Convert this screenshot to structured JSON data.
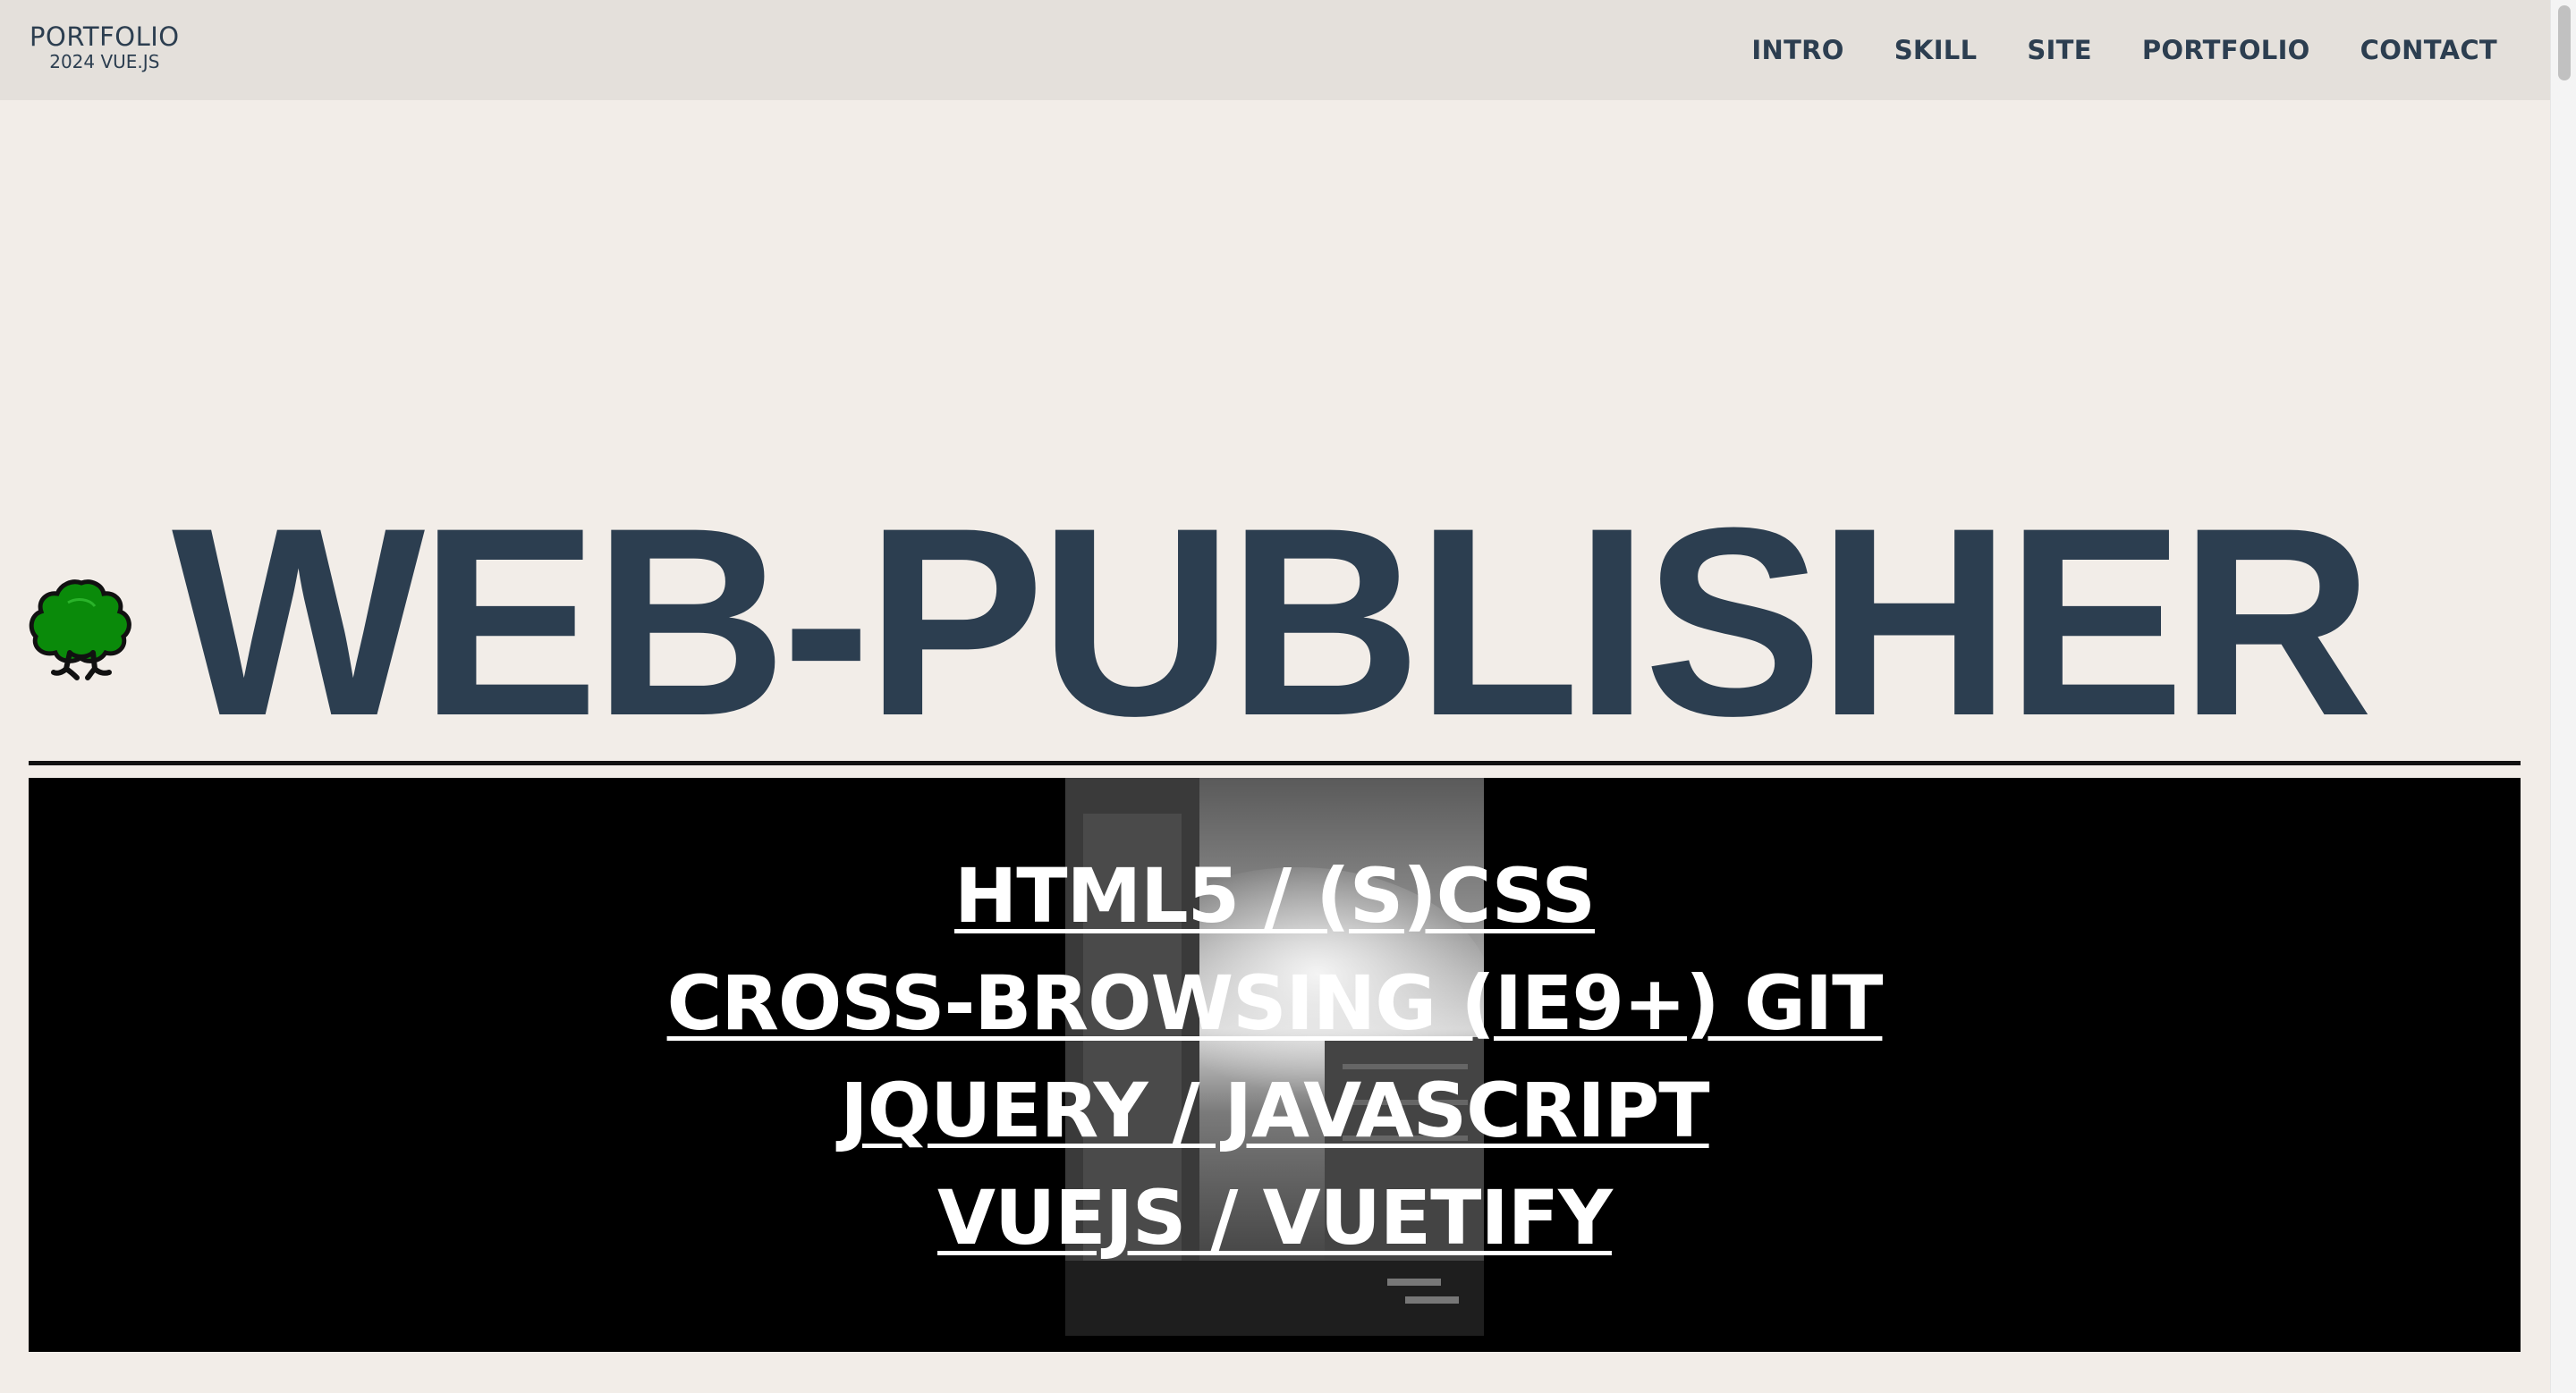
{
  "header": {
    "logo_title": "PORTFOLIO",
    "logo_subtitle": "2024 VUE.JS",
    "nav": [
      {
        "label": "INTRO"
      },
      {
        "label": "SKILL"
      },
      {
        "label": "SITE"
      },
      {
        "label": "PORTFOLIO"
      },
      {
        "label": "CONTACT"
      }
    ]
  },
  "hero": {
    "icon": "tree-icon",
    "title": "WEB-PUBLISHER"
  },
  "skills": {
    "background_image": "city-street-photo",
    "items": [
      {
        "label": "HTML5 / (S)CSS"
      },
      {
        "label": "CROSS-BROWSING (IE9+) GIT"
      },
      {
        "label": "JQUERY / JAVASCRIPT"
      },
      {
        "label": "VUEJS / VUETIFY"
      }
    ]
  },
  "colors": {
    "text": "#2c3e50",
    "page_bg": "#f2ede8",
    "header_bg": "#e4e0db",
    "skills_bg": "#000000",
    "tree_green": "#0a8a0a"
  }
}
